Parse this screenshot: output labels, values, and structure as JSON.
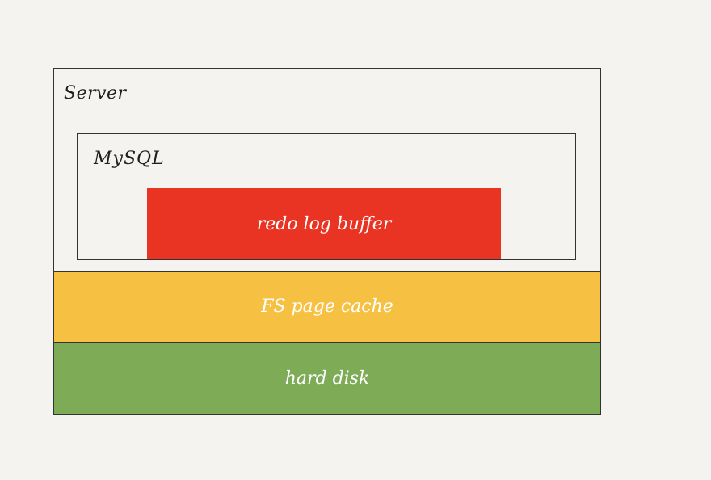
{
  "diagram": {
    "server": {
      "label": "Server"
    },
    "mysql": {
      "label": "MySQL"
    },
    "redo_log_buffer": {
      "label": "redo log buffer",
      "color": "#e93323"
    },
    "fs_page_cache": {
      "label": "FS page cache",
      "color": "#f6c142"
    },
    "hard_disk": {
      "label": "hard disk",
      "color": "#7eab55"
    }
  }
}
